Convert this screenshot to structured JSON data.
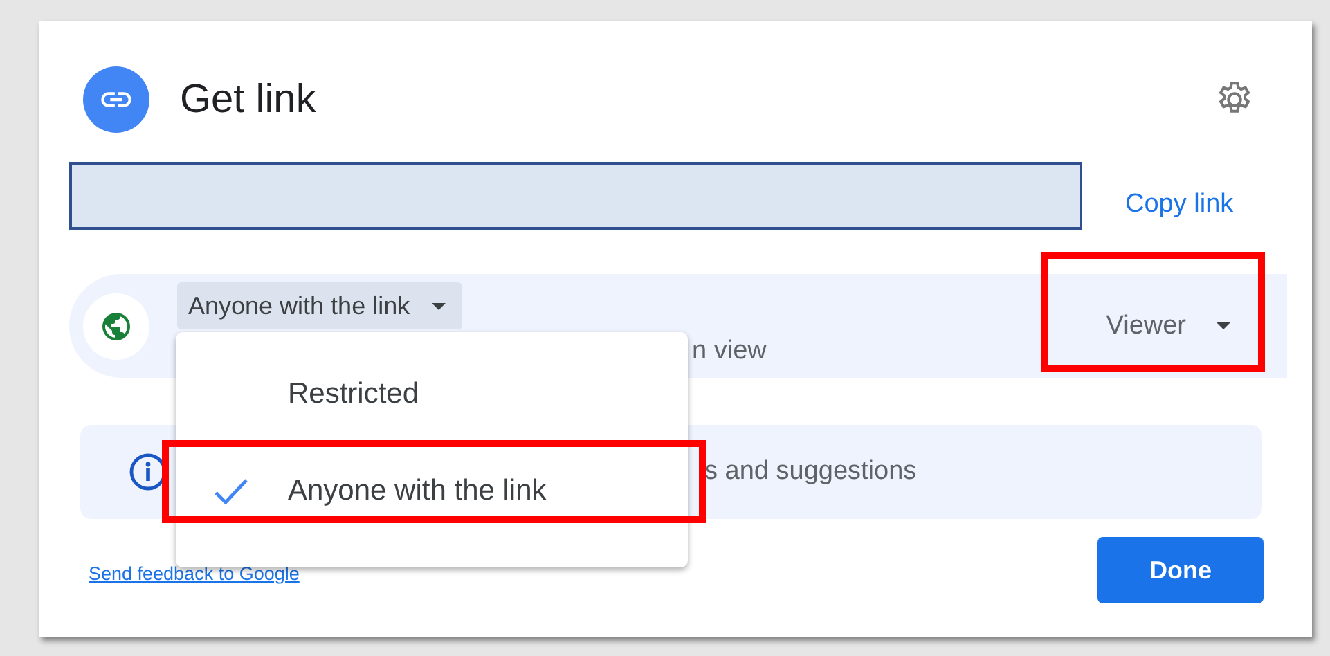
{
  "dialog": {
    "title": "Get link",
    "copy_link": "Copy link"
  },
  "access": {
    "scope": "Anyone with the link",
    "description": "n view",
    "role": "Viewer",
    "role_highlighted": true
  },
  "scope_menu": {
    "items": [
      {
        "label": "Restricted",
        "selected": false,
        "highlighted": false
      },
      {
        "label": "Anyone with the link",
        "selected": true,
        "highlighted": true
      }
    ]
  },
  "info_banner": {
    "text": "s and suggestions"
  },
  "feedback_link": "Send feedback to Google",
  "done_button": "Done"
}
